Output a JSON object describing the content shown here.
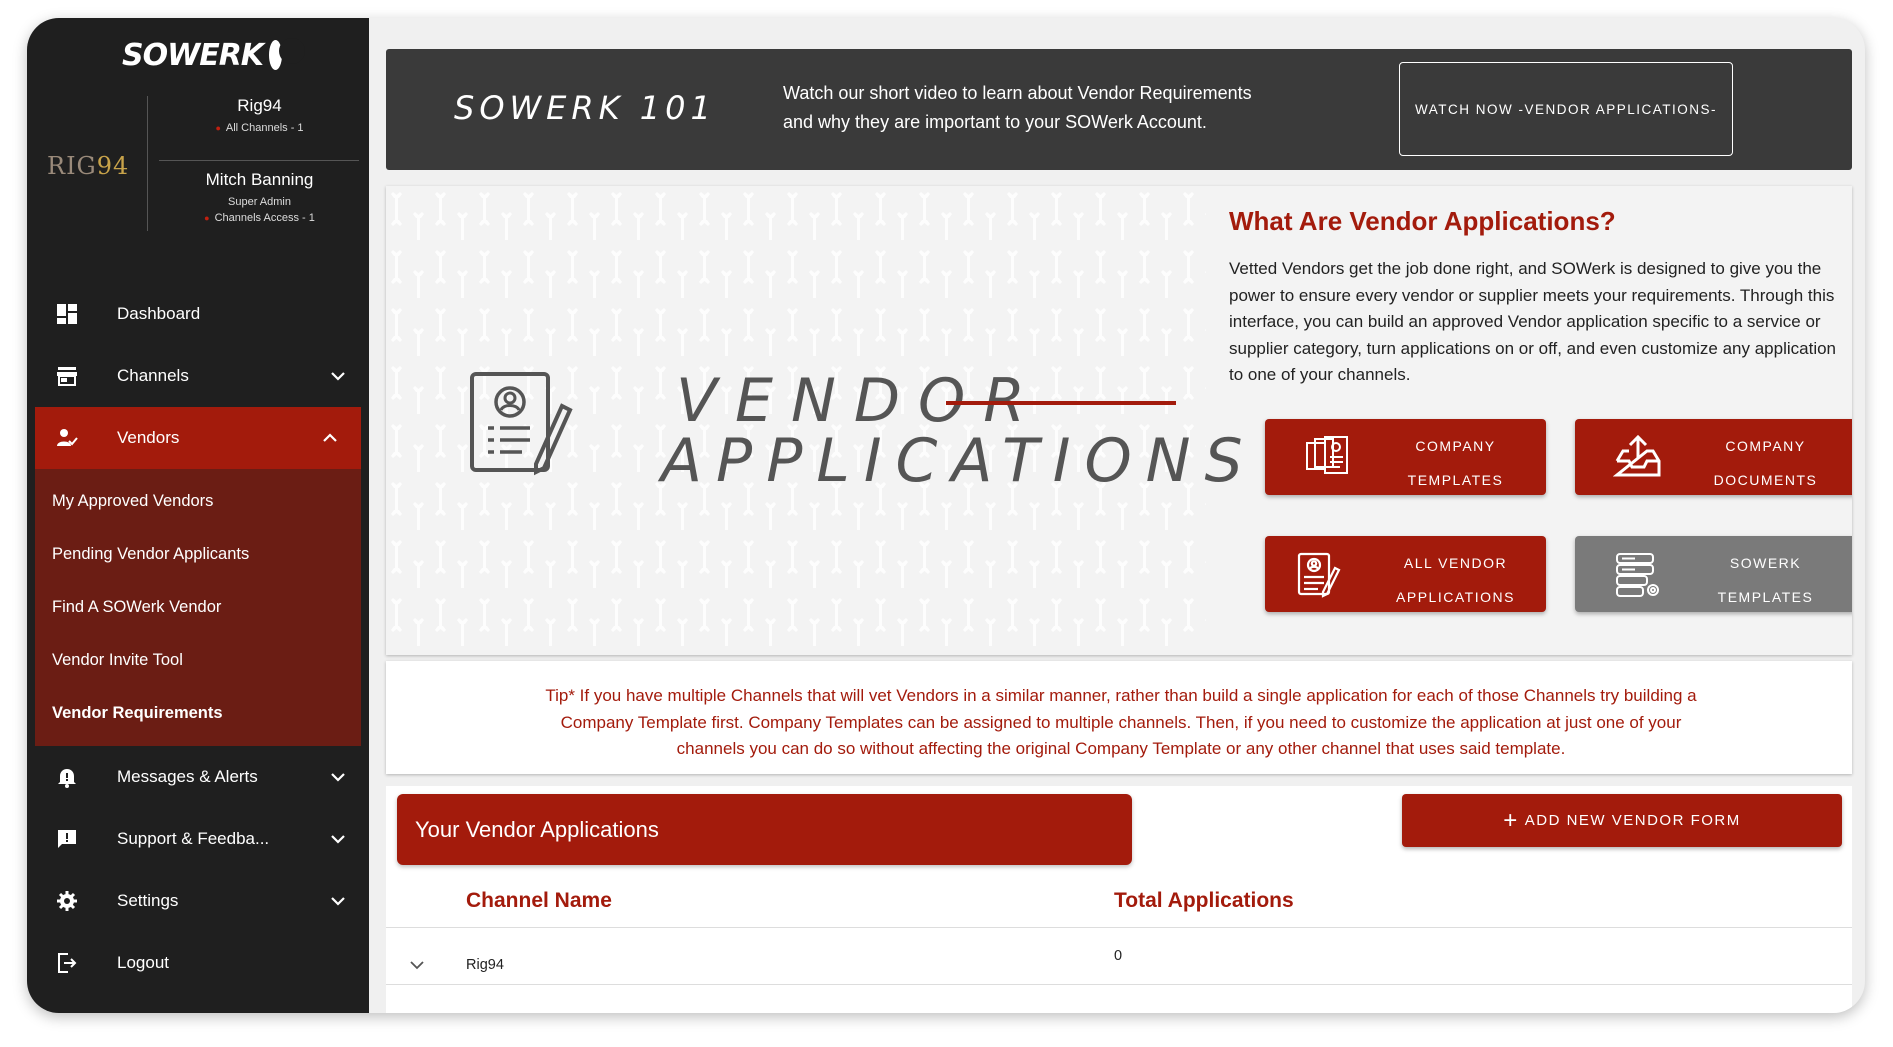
{
  "brand": {
    "logo_text": "SOWERK"
  },
  "org_logo": {
    "text": "RIG",
    "num": "94"
  },
  "account": {
    "org_name": "Rig94",
    "org_channels": "All Channels - 1",
    "user_name": "Mitch Banning",
    "user_role": "Super Admin",
    "user_channels": "Channels Access - 1"
  },
  "nav": {
    "dashboard": "Dashboard",
    "channels": "Channels",
    "vendors": "Vendors",
    "messages": "Messages & Alerts",
    "support": "Support & Feedba...",
    "settings": "Settings",
    "logout": "Logout"
  },
  "vendors_submenu": [
    "My Approved Vendors",
    "Pending Vendor Applicants",
    "Find A SOWerk Vendor",
    "Vendor Invite Tool",
    "Vendor Requirements"
  ],
  "banner": {
    "title": "SOWERK 101",
    "text": "Watch our short video to learn about Vendor Requirements and why they are important to your SOWerk Account.",
    "button": "WATCH NOW -VENDOR APPLICATIONS-"
  },
  "hero": {
    "graphic_word1": "VENDOR",
    "graphic_word2": "APPLICATIONS",
    "title": "What Are Vendor Applications?",
    "description": "Vetted Vendors get the job done right, and SOWerk is designed to give you the power to ensure every vendor or supplier meets your requirements. Through this interface, you can build an approved Vendor application specific to a service or supplier category, turn applications on or off, and even customize any application to one of your channels.",
    "tiles": {
      "company_templates": [
        "COMPANY",
        "TEMPLATES"
      ],
      "company_documents": [
        "COMPANY",
        "DOCUMENTS"
      ],
      "all_vendor_applications": [
        "ALL VENDOR",
        "APPLICATIONS"
      ],
      "sowerk_templates": [
        "SOWERK",
        "TEMPLATES"
      ]
    }
  },
  "tip": {
    "text": "Tip* If you have multiple Channels that will vet Vendors in a similar manner, rather than build a single application for each of those Channels try building a Company Template first. Company Templates can be assigned to multiple channels. Then, if you need to customize the application at just one of your channels you can do so without affecting the original Company Template or any other channel that uses said template."
  },
  "applications": {
    "header": "Your Vendor Applications",
    "add_button": "ADD NEW VENDOR FORM",
    "columns": [
      "Channel Name",
      "Total Applications"
    ],
    "rows": [
      {
        "channel": "Rig94",
        "total": "0"
      }
    ]
  },
  "colors": {
    "accent": "#a31b0c",
    "sidebar": "#1f1f1f",
    "banner": "#3a3a3a",
    "submenu": "#6b1d14",
    "gray_tile": "#7a7a7a"
  }
}
